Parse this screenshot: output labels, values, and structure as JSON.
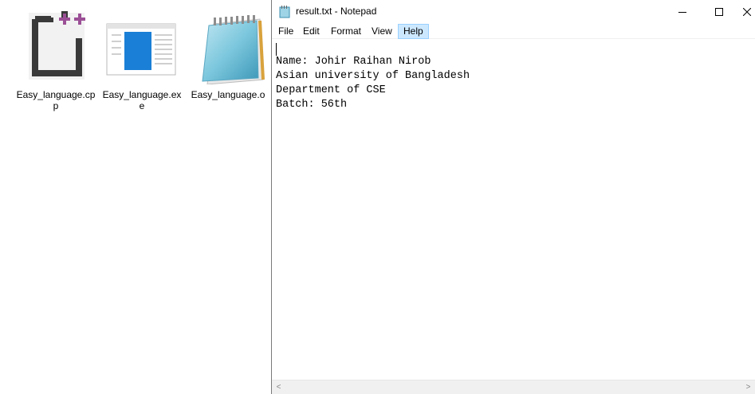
{
  "files": [
    {
      "name": "Easy_language.cpp",
      "icon": "cpp-file-icon"
    },
    {
      "name": "Easy_language.exe",
      "icon": "exe-file-icon"
    },
    {
      "name": "Easy_language.o",
      "icon": "notepad-file-icon"
    }
  ],
  "notepad": {
    "title": "result.txt - Notepad",
    "menu": [
      "File",
      "Edit",
      "Format",
      "View",
      "Help"
    ],
    "active_menu": "Help",
    "content": "Name: Johir Raihan Nirob\nAsian university of Bangladesh\nDepartment of CSE\nBatch: 56th",
    "scroll_left": "<",
    "scroll_right": ">"
  },
  "colors": {
    "cpp_plus": "#9b4f96",
    "exe_blue": "#1a7fd6",
    "menu_highlight": "#cce8ff"
  }
}
